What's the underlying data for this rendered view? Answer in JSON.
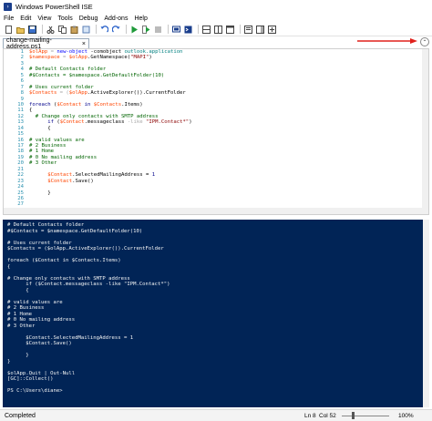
{
  "window": {
    "title": "Windows PowerShell ISE",
    "icon": "powershell-icon"
  },
  "menu": [
    "File",
    "Edit",
    "View",
    "Tools",
    "Debug",
    "Add-ons",
    "Help"
  ],
  "toolbar": {
    "icons": [
      "new-icon",
      "open-icon",
      "save-icon",
      "cut-icon",
      "copy-icon",
      "paste-icon",
      "clear-icon",
      "undo-icon",
      "redo-icon",
      "run-icon",
      "run-selection-icon",
      "stop-icon",
      "remote-icon",
      "powershell-tab-icon",
      "layout-top-icon",
      "layout-right-icon",
      "layout-max-icon",
      "show-script-icon",
      "show-commands-icon",
      "commands-addon-icon"
    ]
  },
  "tab": {
    "label": "change-mailing-address.ps1",
    "close": "×"
  },
  "editor": {
    "line_numbers": [
      "1",
      "2",
      "3",
      "4",
      "5",
      "6",
      "7",
      "8",
      "9",
      "10",
      "11",
      "12",
      "13",
      "14",
      "15",
      "16",
      "17",
      "18",
      "19",
      "20",
      "21",
      "22",
      "23",
      "24",
      "25",
      "26",
      "27"
    ],
    "lines": [
      [
        {
          "t": "$olApp",
          "c": "k-var"
        },
        {
          "t": " = ",
          "c": "k-op"
        },
        {
          "t": "new-object",
          "c": "k-cmd"
        },
        {
          "t": " -comobject ",
          "c": "k-mem"
        },
        {
          "t": "outlook.application",
          "c": "k-typ"
        }
      ],
      [
        {
          "t": "$namespace",
          "c": "k-var"
        },
        {
          "t": " = ",
          "c": "k-op"
        },
        {
          "t": "$olApp",
          "c": "k-var"
        },
        {
          "t": ".GetNamespace(",
          "c": "k-mem"
        },
        {
          "t": "\"MAPI\"",
          "c": "k-str"
        },
        {
          "t": ")",
          "c": "k-mem"
        }
      ],
      [
        {
          "t": "",
          "c": "k-mem"
        }
      ],
      [
        {
          "t": "# Default Contacts folder",
          "c": "k-com"
        }
      ],
      [
        {
          "t": "#$Contacts = $namespace.GetDefaultFolder(10)",
          "c": "k-com"
        }
      ],
      [
        {
          "t": "",
          "c": "k-mem"
        }
      ],
      [
        {
          "t": "# Uses current folder",
          "c": "k-com"
        }
      ],
      [
        {
          "t": "$Contacts",
          "c": "k-var"
        },
        {
          "t": " = (",
          "c": "k-op"
        },
        {
          "t": "$olApp",
          "c": "k-var"
        },
        {
          "t": ".ActiveExplorer()).CurrentFolder",
          "c": "k-mem"
        }
      ],
      [
        {
          "t": "",
          "c": "k-mem"
        }
      ],
      [
        {
          "t": "foreach",
          "c": "k-kw"
        },
        {
          "t": " (",
          "c": "k-mem"
        },
        {
          "t": "$Contact",
          "c": "k-var"
        },
        {
          "t": " in ",
          "c": "k-kw"
        },
        {
          "t": "$Contacts",
          "c": "k-var"
        },
        {
          "t": ".Items)",
          "c": "k-mem"
        }
      ],
      [
        {
          "t": "{",
          "c": "k-mem"
        }
      ],
      [
        {
          "t": "  # Change only contacts with SMTP address",
          "c": "k-com"
        }
      ],
      [
        {
          "t": "      if",
          "c": "k-kw"
        },
        {
          "t": " (",
          "c": "k-mem"
        },
        {
          "t": "$Contact",
          "c": "k-var"
        },
        {
          "t": ".messageclass ",
          "c": "k-mem"
        },
        {
          "t": "-like",
          "c": "k-op"
        },
        {
          "t": " ",
          "c": "k-mem"
        },
        {
          "t": "\"IPM.Contact*\"",
          "c": "k-str"
        },
        {
          "t": ")",
          "c": "k-mem"
        }
      ],
      [
        {
          "t": "      {",
          "c": "k-mem"
        }
      ],
      [
        {
          "t": "",
          "c": "k-mem"
        }
      ],
      [
        {
          "t": "# valid values are",
          "c": "k-com"
        }
      ],
      [
        {
          "t": "# 2 Business",
          "c": "k-com"
        }
      ],
      [
        {
          "t": "# 1 Home",
          "c": "k-com"
        }
      ],
      [
        {
          "t": "# 0 No mailing address",
          "c": "k-com"
        }
      ],
      [
        {
          "t": "# 3 Other",
          "c": "k-com"
        }
      ],
      [
        {
          "t": "",
          "c": "k-mem"
        }
      ],
      [
        {
          "t": "      $Contact",
          "c": "k-var"
        },
        {
          "t": ".SelectedMailingAddress = ",
          "c": "k-mem"
        },
        {
          "t": "1",
          "c": "k-kw"
        }
      ],
      [
        {
          "t": "      $Contact",
          "c": "k-var"
        },
        {
          "t": ".Save()",
          "c": "k-mem"
        }
      ],
      [
        {
          "t": "",
          "c": "k-mem"
        }
      ],
      [
        {
          "t": "      }",
          "c": "k-mem"
        }
      ],
      [
        {
          "t": "",
          "c": "k-mem"
        }
      ],
      [
        {
          "t": "",
          "c": "k-mem"
        }
      ]
    ]
  },
  "console": {
    "lines": [
      "# Default Contacts folder",
      "#$Contacts = $namespace.GetDefaultFolder(10)",
      "",
      "# Uses current folder",
      "$Contacts = ($olApp.ActiveExplorer()).CurrentFolder",
      "",
      "foreach ($Contact in $Contacts.Items)",
      "{",
      "",
      "# Change only contacts with SMTP address",
      "      if ($Contact.messageclass -like \"IPM.Contact*\")",
      "      {",
      "",
      "# valid values are",
      "# 2 Business",
      "# 1 Home",
      "# 0 No mailing address",
      "# 3 Other",
      "",
      "      $Contact.SelectedMailingAddress = 1",
      "      $Contact.Save()",
      "",
      "      }",
      "}",
      "",
      "$olApp.Quit | Out-Null",
      "[GC]::Collect()",
      "",
      "PS C:\\Users\\diane>"
    ]
  },
  "status": {
    "text": "Completed",
    "line": "Ln 8",
    "col": "Col 52",
    "zoom": "100%"
  },
  "colors": {
    "console_bg": "#012456",
    "arrow": "#e0201b"
  }
}
